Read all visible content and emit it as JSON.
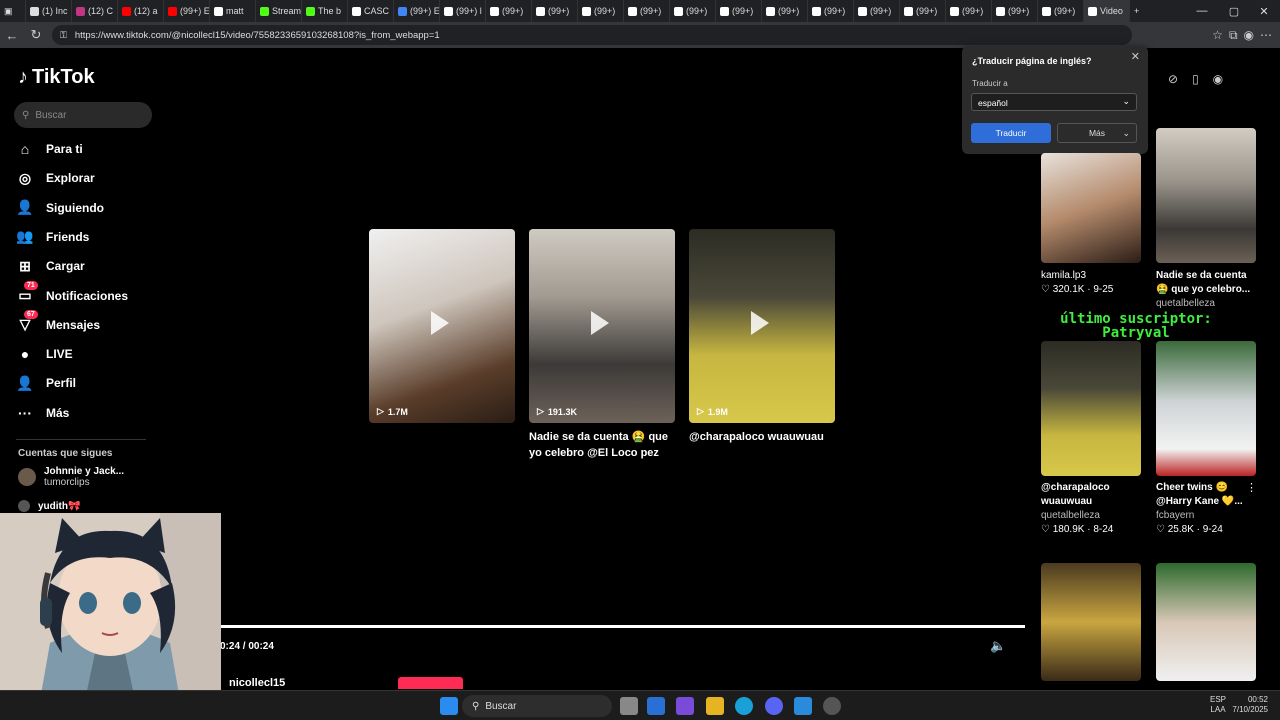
{
  "browser": {
    "tabs": [
      {
        "label": "(1) Inc",
        "color": "#ddd"
      },
      {
        "label": "(12) C",
        "color": "#c13584"
      },
      {
        "label": "(12) a",
        "color": "#ff0000"
      },
      {
        "label": "(99+) E",
        "color": "#ff0000"
      },
      {
        "label": "matt",
        "color": "#fff"
      },
      {
        "label": "Stream",
        "color": "#53fc18"
      },
      {
        "label": "The b",
        "color": "#53fc18"
      },
      {
        "label": "CASC",
        "color": "#fff"
      },
      {
        "label": "(99+) E",
        "color": "#4285f4"
      },
      {
        "label": "(99+) l",
        "color": "#fff"
      },
      {
        "label": "(99+) ",
        "color": "#fff"
      },
      {
        "label": "(99+) ",
        "color": "#fff"
      },
      {
        "label": "(99+) ",
        "color": "#fff"
      },
      {
        "label": "(99+) ",
        "color": "#fff"
      },
      {
        "label": "(99+) ",
        "color": "#fff"
      },
      {
        "label": "(99+) ",
        "color": "#fff"
      },
      {
        "label": "(99+) ",
        "color": "#fff"
      },
      {
        "label": "(99+) ",
        "color": "#fff"
      },
      {
        "label": "(99+) ",
        "color": "#fff"
      },
      {
        "label": "(99+) ",
        "color": "#fff"
      },
      {
        "label": "(99+) ",
        "color": "#fff"
      },
      {
        "label": "(99+) ",
        "color": "#fff"
      },
      {
        "label": "(99+) ",
        "color": "#fff"
      },
      {
        "label": "Video",
        "color": "#fff"
      }
    ],
    "url": "https://www.tiktok.com/@nicollecl15/video/7558233659103268108?is_from_webapp=1"
  },
  "sidebar": {
    "logo": "TikTok",
    "search_placeholder": "Buscar",
    "items": [
      {
        "label": "Para ti",
        "icon": "home-icon",
        "glyph": "⌂"
      },
      {
        "label": "Explorar",
        "icon": "compass-icon",
        "glyph": "◎"
      },
      {
        "label": "Siguiendo",
        "icon": "following-icon",
        "glyph": "👤"
      },
      {
        "label": "Friends",
        "icon": "friends-icon",
        "glyph": "👥"
      },
      {
        "label": "Cargar",
        "icon": "upload-icon",
        "glyph": "⊞"
      },
      {
        "label": "Notificaciones",
        "icon": "notifications-icon",
        "glyph": "▭",
        "badge": "71"
      },
      {
        "label": "Mensajes",
        "icon": "messages-icon",
        "glyph": "▽",
        "badge": "67"
      },
      {
        "label": "LIVE",
        "icon": "live-icon",
        "glyph": "●"
      },
      {
        "label": "Perfil",
        "icon": "profile-icon",
        "glyph": "👤"
      },
      {
        "label": "Más",
        "icon": "more-icon",
        "glyph": "···"
      }
    ],
    "following_title": "Cuentas que sigues",
    "following": [
      {
        "name": "Johnnie y Jack...",
        "sub": "tumorclips"
      },
      {
        "name": "yudith🎀",
        "sub": ""
      }
    ]
  },
  "main": {
    "cards": [
      {
        "views": "1.7M",
        "caption": ""
      },
      {
        "views": "191.3K",
        "caption": "Nadie se da cuenta 🤮 que yo celebro @El Loco pez"
      },
      {
        "views": "1.9M",
        "caption": "@charapaloco wuauwuau"
      }
    ],
    "time": "0:24 / 00:24",
    "progress": 1.0,
    "author": "nicollecl15"
  },
  "translate_popup": {
    "title": "¿Traducir página de inglés?",
    "to_label": "Traducir a",
    "language": "español",
    "translate_btn": "Traducir",
    "more_btn": "Más"
  },
  "right_panel": {
    "videos": [
      {
        "title": "kamila.lp3",
        "author": "",
        "stats": "♡ 320.1K · 9-25"
      },
      {
        "title": "Nadie se da cuenta 🤮 que yo celebro...",
        "author": "quetalbelleza",
        "stats": ""
      },
      {
        "title": "@charapaloco wuauwuau",
        "author": "quetalbelleza",
        "stats": "♡ 180.9K · 8-24"
      },
      {
        "title": "Cheer twins 😊 @Harry Kane 💛...",
        "author": "fcbayern",
        "stats": "♡ 25.8K · 9-24"
      }
    ]
  },
  "stream_overlay": {
    "line1": "último suscriptor:",
    "line2": "Patryval"
  },
  "taskbar": {
    "search": "Buscar",
    "lang1": "ESP",
    "lang2": "LAA",
    "time": "00:52",
    "date": "7/10/2025"
  }
}
